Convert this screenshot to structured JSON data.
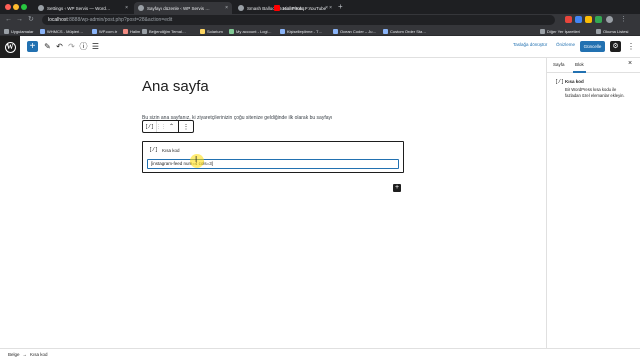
{
  "browser": {
    "tabs": [
      {
        "title": "Settings ‹ WP Servis — Word…",
        "active": false,
        "favicon": "wordpress-icon"
      },
      {
        "title": "Sayfayı düzenle ‹ WP Servis …",
        "active": true,
        "favicon": "wordpress-icon"
      },
      {
        "title": "Smash Balloon Social Photo F…",
        "active": false,
        "favicon": "page-icon"
      },
      {
        "title": "Halim Kılıç - YouTube",
        "active": false,
        "favicon": "youtube-icon"
      }
    ],
    "close_glyph": "×",
    "new_tab_glyph": "+",
    "url_host": "localhost",
    "url_path": ":8888/wp-admin/post.php?post=28&action=edit",
    "bookmarks": [
      {
        "label": "Uygulamalar"
      },
      {
        "label": "WHMCS - Müşteri…"
      },
      {
        "label": "WP.com.tr"
      },
      {
        "label": "Halim"
      },
      {
        "label": "Beğendiğim Temal…"
      },
      {
        "label": "Solarium"
      },
      {
        "label": "My account - Logi…"
      },
      {
        "label": "Kişiselleştirme - T…"
      },
      {
        "label": "Ocean Coder – Ju…"
      },
      {
        "label": "Custom Order Sta…"
      }
    ],
    "bookmarks_right": [
      "Diğer Yer İşaretleri",
      "Okuma Listesi"
    ]
  },
  "editor": {
    "header": {
      "add_block_glyph": "+",
      "save_draft": "Taslağa dönüştür",
      "preview": "Önizleme",
      "update": "Güncelle"
    },
    "page_title": "Ana sayfa",
    "paragraph": "Bu sizin ana sayfanız, ki ziyaretçilerinizin çoğu sitenize geldiğinde ilk olarak bu sayfayı",
    "toolbar": {
      "block_type_icon": "[/]",
      "drag_glyph": "⋮⋮",
      "move_glyph": "⌃",
      "more_glyph": "⋮"
    },
    "shortcode_block": {
      "icon": "[/]",
      "label": "Kısa kod",
      "value": "[instagram-feed num=4 cols=3]"
    },
    "appender_glyph": "+"
  },
  "sidebar": {
    "tabs": [
      "Sayfa",
      "Blok"
    ],
    "active_tab": "Blok",
    "close_glyph": "×",
    "block": {
      "icon": "[/]",
      "title": "Kısa kod",
      "description": "Bir WordPress kısa kodu ile fazladan özel elemanlar ekleyin."
    }
  },
  "breadcrumb": [
    "Belge",
    "→",
    "Kısa kod"
  ],
  "colors": {
    "accent": "#2271b1",
    "dark": "#1e1e1e",
    "chrome_tab": "#35363a",
    "chrome_bg": "#1e1f22",
    "cursor_highlight": "#ffdd00"
  }
}
